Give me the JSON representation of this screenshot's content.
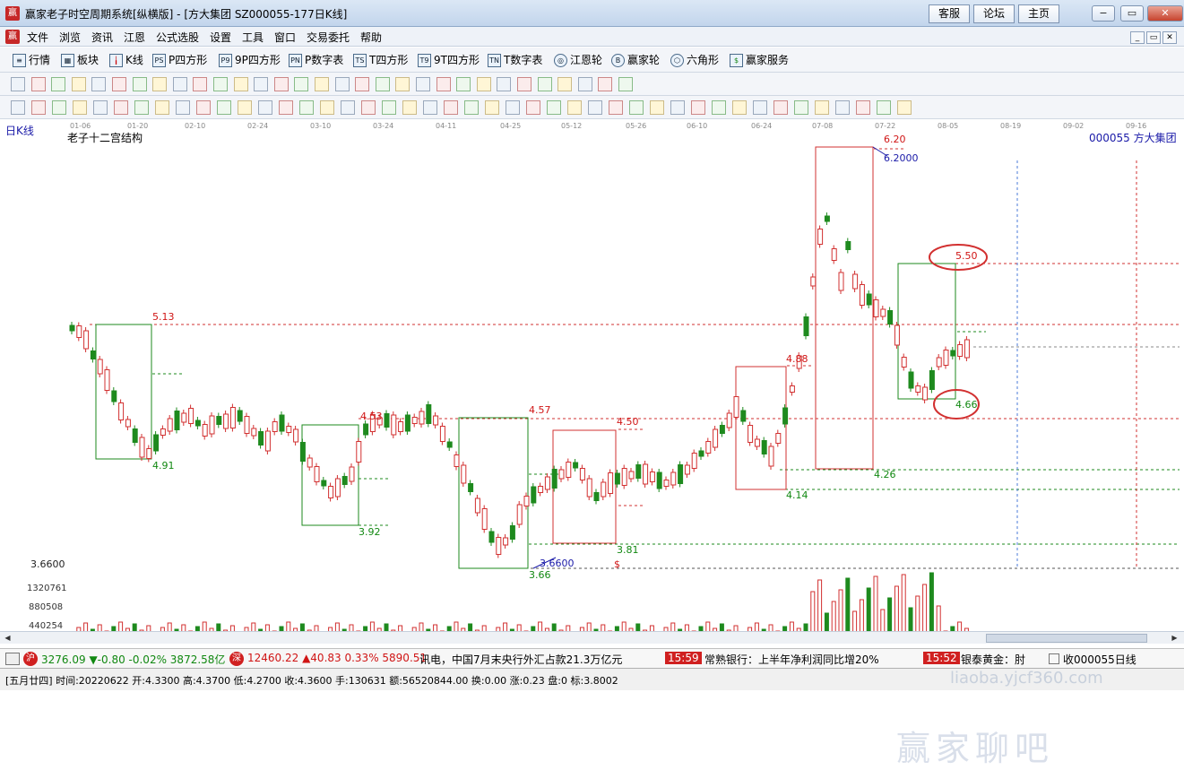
{
  "window": {
    "title": "赢家老子时空周期系统[纵横版] - [方大集团  SZ000055-177日K线]",
    "links": [
      "客服",
      "论坛",
      "主页"
    ],
    "controls": [
      "−",
      "▭",
      "✕"
    ]
  },
  "menu": [
    "文件",
    "浏览",
    "资讯",
    "江恩",
    "公式选股",
    "设置",
    "工具",
    "窗口",
    "交易委托",
    "帮助"
  ],
  "toolbar1": [
    {
      "icon": "list-icon",
      "label": "行情"
    },
    {
      "icon": "grid-icon",
      "label": "板块"
    },
    {
      "icon": "candle-icon",
      "label": "K线"
    },
    {
      "icon": "ps-icon",
      "label": "P四方形"
    },
    {
      "icon": "p9-icon",
      "label": "9P四方形"
    },
    {
      "icon": "pn-icon",
      "label": "P数字表"
    },
    {
      "icon": "ts-icon",
      "label": "T四方形"
    },
    {
      "icon": "t9-icon",
      "label": "9T四方形"
    },
    {
      "icon": "tn-icon",
      "label": "T数字表"
    },
    {
      "icon": "wheel-icon",
      "label": "江恩轮"
    },
    {
      "icon": "big-icon",
      "label": "赢家轮"
    },
    {
      "icon": "hexagon-icon",
      "label": "六角形"
    },
    {
      "icon": "dollar-icon",
      "label": "赢家服务"
    }
  ],
  "chart": {
    "period_label": "日K线",
    "indicator": "老子十二宫结构",
    "stock": "000055  方大集团",
    "dates": [
      "01-06",
      "01-20",
      "02-10",
      "02-24",
      "03-10",
      "03-24",
      "04-11",
      "04-25",
      "05-12",
      "05-26",
      "06-10",
      "06-24",
      "07-08",
      "07-22",
      "08-05",
      "08-19",
      "09-02",
      "09-16"
    ],
    "price_labels": [
      {
        "text": "5.13",
        "color": "red"
      },
      {
        "text": "4.91",
        "color": "grn"
      },
      {
        "text": "4.53",
        "color": "red"
      },
      {
        "text": "3.92",
        "color": "grn"
      },
      {
        "text": "4.57",
        "color": "red"
      },
      {
        "text": "4.50",
        "color": "red"
      },
      {
        "text": "3.81",
        "color": "grn"
      },
      {
        "text": "3.66",
        "color": "grn"
      },
      {
        "text": "3.6600",
        "color": "blu"
      },
      {
        "text": "$",
        "color": "red"
      },
      {
        "text": "4.88",
        "color": "red"
      },
      {
        "text": "4.14",
        "color": "grn"
      },
      {
        "text": "6.20",
        "color": "red"
      },
      {
        "text": "6.2000",
        "color": "blu"
      },
      {
        "text": "4.26",
        "color": "grn"
      },
      {
        "text": "5.50",
        "color": "red"
      },
      {
        "text": "4.66",
        "color": "grn"
      }
    ],
    "left_axis": "3.6600",
    "volume_axis": [
      "1320761",
      "880508",
      "440254"
    ]
  },
  "watermark": {
    "text": "赢家聊吧",
    "sub": "liaoba.yjcf360.com"
  },
  "ticker": {
    "sh_badge": "沪",
    "sh_text": "3276.09 ▼-0.80 -0.02% 3872.58亿",
    "sz_badge": "深",
    "sz_text": "12460.22 ▲40.83 0.33% 5890.51",
    "news1": "讯电，中国7月末央行外汇占款21.3万亿元",
    "time1": "15:59",
    "news2": "常熟银行：上半年净利润同比增20%",
    "time2": "15:52",
    "news3": "银泰黄金：肘",
    "right": "收000055日线"
  },
  "status": {
    "text": "[五月廿四] 时间:20220622 开:4.3300 高:4.3700 低:4.2700 收:4.3600 手:130631 额:56520844.00 换:0.00 涨:0.23 盘:0 标:3.8002"
  }
}
